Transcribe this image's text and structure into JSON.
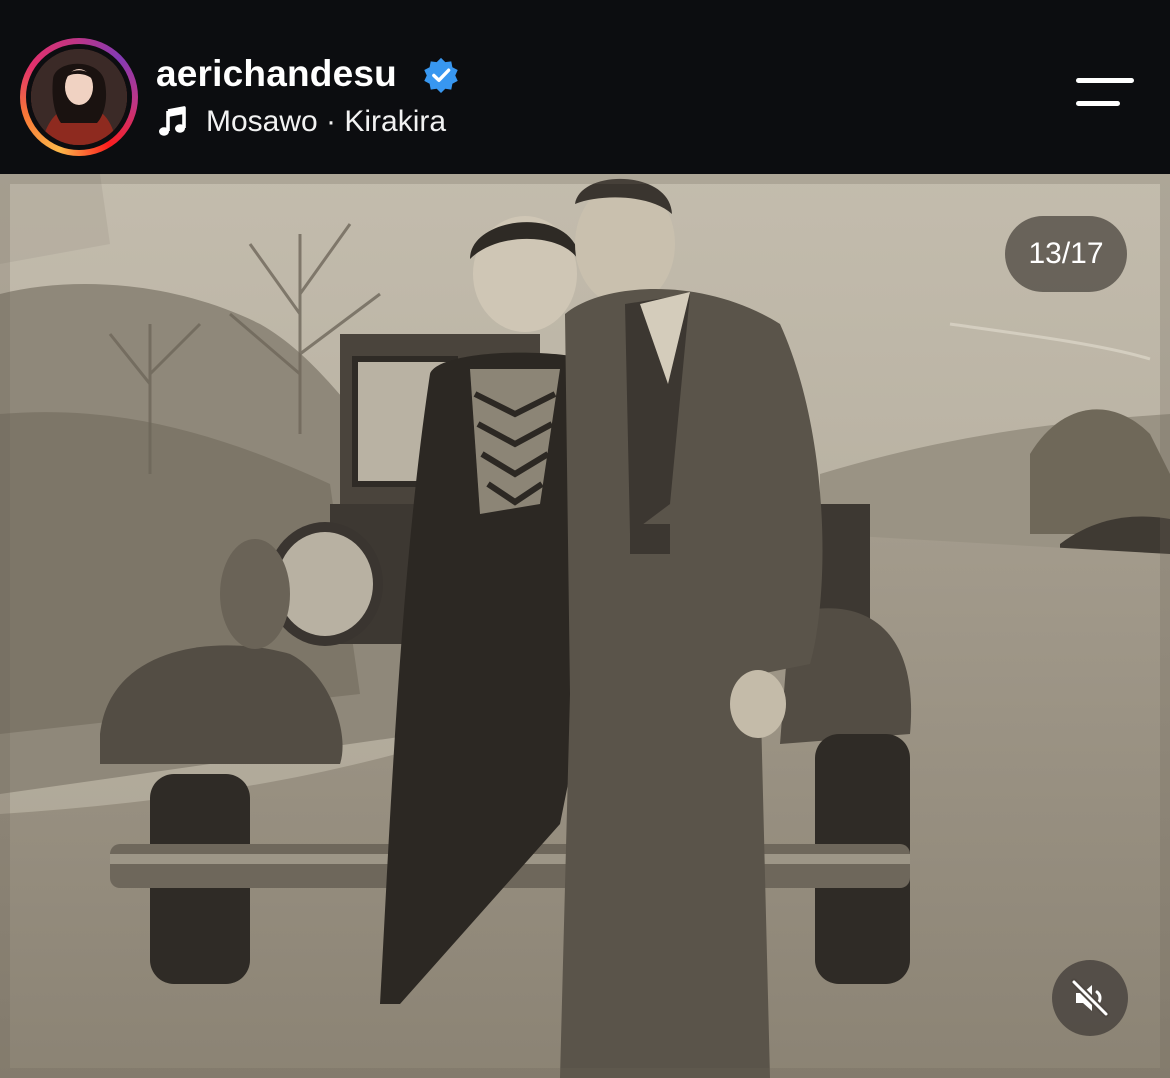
{
  "profile": {
    "username": "aerichandesu",
    "verified": true,
    "avatar_icon": "profile-avatar",
    "story_ring_colors": [
      "#fdb84a",
      "#f77737",
      "#e1306c",
      "#c13584",
      "#833ab4"
    ]
  },
  "audio": {
    "icon": "music-note-icon",
    "track": "Mosawo · Kirakira"
  },
  "menu": {
    "icon": "menu-icon"
  },
  "carousel": {
    "position_label": "13/17",
    "current": 13,
    "total": 17
  },
  "media": {
    "description_icon": "sepia-photo",
    "mute_icon": "speaker-muted-icon"
  },
  "colors": {
    "background": "#0c0d10",
    "text": "#ffffff",
    "verified_badge": "#3897f0",
    "overlay_pill": "#5c564e"
  }
}
